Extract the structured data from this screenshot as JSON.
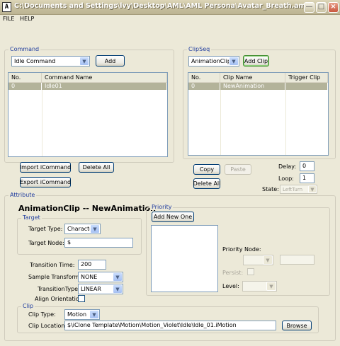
{
  "window": {
    "title": "C:\\Documents and Settings\\lvy\\Desktop\\AML\\AML Persona\\Avatar_Breath.aml",
    "icon_glyph": "A"
  },
  "menu": {
    "file": "FILE",
    "help": "HELP"
  },
  "command": {
    "group_label": "Command",
    "combo_value": "Idle Command",
    "add_label": "Add",
    "columns": [
      "No.",
      "Command Name"
    ],
    "rows": [
      {
        "no": "0",
        "name": "Idle01"
      }
    ],
    "import_label": "Import iCommand",
    "delete_all_label": "Delete All",
    "export_label": "Export iCommand"
  },
  "clipseq": {
    "group_label": "ClipSeq",
    "combo_value": "AnimationClip",
    "add_clip_label": "Add Clip",
    "columns": [
      "No.",
      "Clip Name",
      "Trigger Clip"
    ],
    "rows": [
      {
        "no": "0",
        "name": "NewAnimation",
        "trigger": ""
      }
    ],
    "copy_label": "Copy",
    "paste_label": "Paste",
    "delete_all_label": "Delete All",
    "delay_label": "Delay:",
    "delay_value": "0",
    "loop_label": "Loop:",
    "loop_value": "1",
    "state_label": "State:",
    "state_value": "LeftTurn"
  },
  "attribute": {
    "group_label": "Attribute",
    "title": "AnimationClip --  NewAnimation",
    "target": {
      "group_label": "Target",
      "type_label": "Target Type:",
      "type_value": "Character",
      "node_label": "Target Node:",
      "node_value": "$"
    },
    "transition_time_label": "Transition Time:",
    "transition_time_value": "200",
    "sample_transform_label": "Sample Transform:",
    "sample_transform_value": "NONE",
    "transition_type_label": "TransitionType:",
    "transition_type_value": "LINEAR",
    "align_orientation_label": "Align Orientation:",
    "priority": {
      "group_label": "Priority",
      "add_new_label": "Add New One",
      "priority_node_label": "Priority Node:",
      "persist_label": "Persist:",
      "level_label": "Level:"
    },
    "clip": {
      "group_label": "Clip",
      "type_label": "Clip Type:",
      "type_value": "Motion",
      "location_label": "Clip Location:",
      "location_value": "$\\iClone Template\\Motion\\Motion_Violet\\Idle\\Idle_01.iMotion",
      "browse_label": "Browse"
    }
  }
}
